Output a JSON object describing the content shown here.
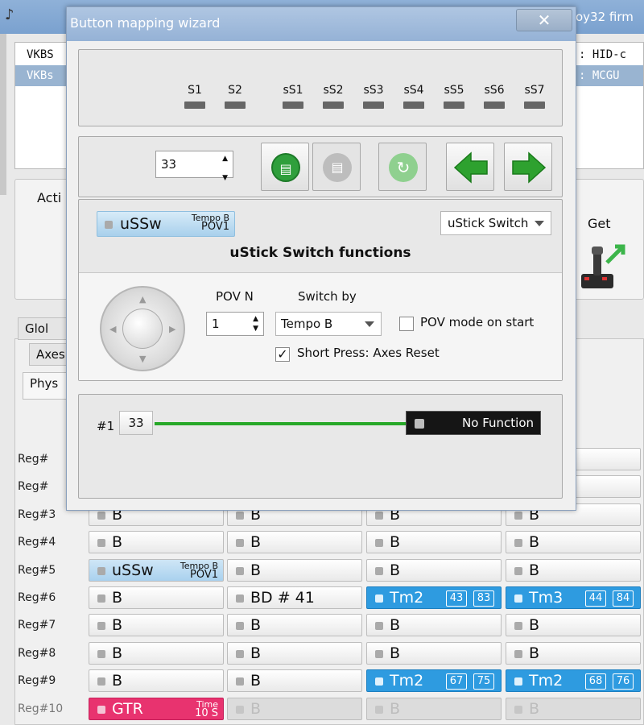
{
  "app": {
    "title_right": "oy32 firm",
    "list_rows": [
      {
        "left": "VKBS",
        "right": ": HID-c"
      },
      {
        "left": "VKBs",
        "right": ": MCGU"
      }
    ],
    "group_label": "Acti",
    "get_label": "Get",
    "tabs": [
      "Glol",
      "Axes",
      "Phys"
    ]
  },
  "dialog": {
    "title": "Button mapping wizard",
    "close": "✕",
    "leds": [
      "S1",
      "S2",
      "sS1",
      "sS2",
      "sS3",
      "sS4",
      "sS5",
      "sS6",
      "sS7"
    ],
    "button_number": "33",
    "mapping": {
      "label": "uSSw",
      "top": "Tempo B",
      "bottom": "POV1"
    },
    "function_select": "uStick Switch",
    "function_title": "uStick Switch functions",
    "pov_label": "POV N",
    "pov_value": "1",
    "switch_label": "Switch by",
    "switch_value": "Tempo B",
    "pov_mode_label": "POV mode on start",
    "pov_mode_checked": false,
    "short_press_label": "Short Press: Axes Reset",
    "short_press_checked": true,
    "output_index": "#1",
    "output_button": "33",
    "output_function": "No Function"
  },
  "grid": {
    "rows": [
      {
        "label": "Reg#",
        "cells": []
      },
      {
        "label": "Reg#",
        "cells": []
      },
      {
        "label": "Reg#3",
        "cells": [
          {
            "t": "B"
          },
          {
            "t": "B"
          },
          {
            "t": "B"
          },
          {
            "t": "B"
          }
        ]
      },
      {
        "label": "Reg#4",
        "cells": [
          {
            "t": "B"
          },
          {
            "t": "B"
          },
          {
            "t": "B"
          },
          {
            "t": "B"
          }
        ]
      },
      {
        "label": "Reg#5",
        "cells": [
          {
            "t": "uSSw",
            "style": "lightblue",
            "top": "Tempo B",
            "bottom": "POV1"
          },
          {
            "t": "B"
          },
          {
            "t": "B"
          },
          {
            "t": "B"
          }
        ]
      },
      {
        "label": "Reg#6",
        "cells": [
          {
            "t": "B"
          },
          {
            "t": "BD  # 41"
          },
          {
            "t": "Tm2",
            "style": "blue",
            "b1": "43",
            "b2": "83"
          },
          {
            "t": "Tm3",
            "style": "blue",
            "b1": "44",
            "b2": "84"
          }
        ]
      },
      {
        "label": "Reg#7",
        "cells": [
          {
            "t": "B"
          },
          {
            "t": "B"
          },
          {
            "t": "B"
          },
          {
            "t": "B"
          }
        ]
      },
      {
        "label": "Reg#8",
        "cells": [
          {
            "t": "B"
          },
          {
            "t": "B"
          },
          {
            "t": "B"
          },
          {
            "t": "B"
          }
        ]
      },
      {
        "label": "Reg#9",
        "cells": [
          {
            "t": "B"
          },
          {
            "t": "B"
          },
          {
            "t": "Tm2",
            "style": "blue",
            "b1": "67",
            "b2": "75"
          },
          {
            "t": "Tm2",
            "style": "blue",
            "b1": "68",
            "b2": "76"
          }
        ]
      },
      {
        "label": "Reg#10",
        "cells": [
          {
            "t": "GTR",
            "style": "pink",
            "top": "Time",
            "bottom": "10 S"
          },
          {
            "t": "B",
            "style": "gray"
          },
          {
            "t": "B",
            "style": "gray"
          },
          {
            "t": "B",
            "style": "gray"
          }
        ]
      }
    ]
  }
}
